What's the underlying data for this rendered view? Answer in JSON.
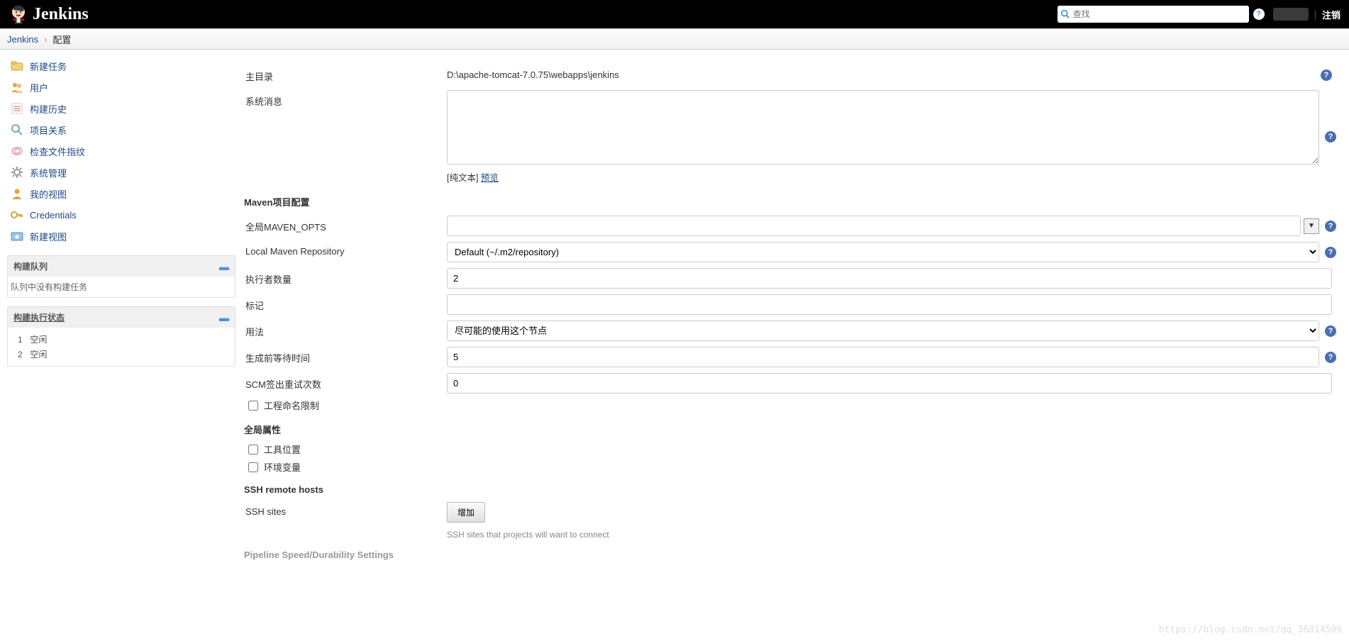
{
  "header": {
    "brand": "Jenkins",
    "search_placeholder": "查找",
    "logout_label": "注销"
  },
  "breadcrumb": {
    "root": "Jenkins",
    "current": "配置"
  },
  "sidebar": {
    "items": [
      {
        "label": "新建任务"
      },
      {
        "label": "用户"
      },
      {
        "label": "构建历史"
      },
      {
        "label": "项目关系"
      },
      {
        "label": "检查文件指纹"
      },
      {
        "label": "系统管理"
      },
      {
        "label": "我的视图"
      },
      {
        "label": "Credentials"
      },
      {
        "label": "新建视图"
      }
    ],
    "queue_title": "构建队列",
    "queue_empty": "队列中没有构建任务",
    "exec_title": "构建执行状态",
    "executors": [
      {
        "idx": "1",
        "state": "空闲"
      },
      {
        "idx": "2",
        "state": "空闲"
      }
    ]
  },
  "form": {
    "home_dir_label": "主目录",
    "home_dir_value": "D:\\apache-tomcat-7.0.75\\webapps\\jenkins",
    "sysmsg_label": "系统消息",
    "sysmsg_hint_prefix": "[纯文本] ",
    "sysmsg_preview": "预览",
    "maven_section": "Maven项目配置",
    "maven_opts_label": "全局MAVEN_OPTS",
    "maven_repo_label": "Local Maven Repository",
    "maven_repo_selected": "Default (~/.m2/repository)",
    "executors_count_label": "执行者数量",
    "executors_count_value": "2",
    "label_label": "标记",
    "usage_label": "用法",
    "usage_selected": "尽可能的使用这个节点",
    "quiet_label": "生成前等待时间",
    "quiet_value": "5",
    "scm_retry_label": "SCM签出重试次数",
    "scm_retry_value": "0",
    "naming_cb_label": "工程命名限制",
    "global_props_section": "全局属性",
    "tool_loc_cb": "工具位置",
    "env_var_cb": "环境变量",
    "ssh_section": "SSH remote hosts",
    "ssh_sites_label": "SSH sites",
    "ssh_add_btn": "增加",
    "ssh_hint": "SSH sites that projects will want to connect",
    "pipeline_section": "Pipeline Speed/Durability Settings"
  },
  "watermark": "https://blog.csdn.net/qq_36014509"
}
